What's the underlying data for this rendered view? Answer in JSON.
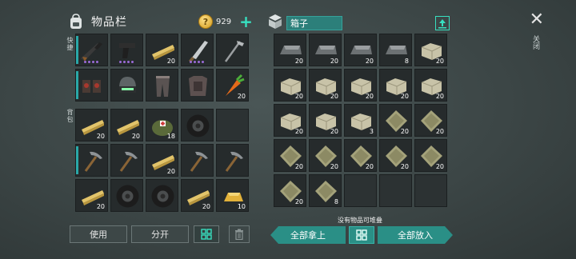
{
  "inventory": {
    "title": "物品栏",
    "coins": "929",
    "hotbar_label": "快捷",
    "backpack_label": "背包",
    "hotbar": [
      {
        "icon": "rifle-icon",
        "qty": "",
        "dots": 4
      },
      {
        "icon": "pistol-icon",
        "qty": "",
        "dots": 4
      },
      {
        "icon": "plank-icon",
        "qty": "20",
        "dots": 0
      },
      {
        "icon": "machete-icon",
        "qty": "",
        "dots": 4
      },
      {
        "icon": "hoe-icon",
        "qty": "",
        "dots": 0
      },
      {
        "icon": "boots-icon",
        "qty": "",
        "dots": 0
      },
      {
        "icon": "helmet-icon",
        "qty": "",
        "dots": 0
      },
      {
        "icon": "pants-icon",
        "qty": "",
        "dots": 0
      },
      {
        "icon": "chest-armor-icon",
        "qty": "",
        "dots": 0
      },
      {
        "icon": "carrot-icon",
        "qty": "20",
        "dots": 0
      }
    ],
    "backpack": [
      {
        "icon": "plank-icon",
        "qty": "20"
      },
      {
        "icon": "plank-icon",
        "qty": "20"
      },
      {
        "icon": "medkit-bag-icon",
        "qty": "18"
      },
      {
        "icon": "tire-icon",
        "qty": ""
      },
      {
        "icon": "",
        "qty": ""
      },
      {
        "icon": "pickaxe-icon",
        "qty": ""
      },
      {
        "icon": "pickaxe-icon",
        "qty": ""
      },
      {
        "icon": "plank-icon",
        "qty": "20"
      },
      {
        "icon": "pickaxe-icon",
        "qty": ""
      },
      {
        "icon": "pickaxe-icon",
        "qty": ""
      },
      {
        "icon": "plank-icon",
        "qty": "20"
      },
      {
        "icon": "tire-icon",
        "qty": ""
      },
      {
        "icon": "tire-icon",
        "qty": ""
      },
      {
        "icon": "plank-icon",
        "qty": "20"
      },
      {
        "icon": "gold-bar-icon",
        "qty": "10"
      }
    ],
    "use_label": "使用",
    "split_label": "分开"
  },
  "container": {
    "title": "箱子",
    "no_stack_text": "没有物品可堆叠",
    "take_all_label": "全部拿上",
    "put_all_label": "全部放入",
    "slots": [
      {
        "icon": "iron-ingot-icon",
        "qty": "20"
      },
      {
        "icon": "iron-ingot-icon",
        "qty": "20"
      },
      {
        "icon": "iron-ingot-icon",
        "qty": "20"
      },
      {
        "icon": "iron-ingot-icon",
        "qty": "8"
      },
      {
        "icon": "stone-block-icon",
        "qty": "20"
      },
      {
        "icon": "stone-block-icon",
        "qty": "20"
      },
      {
        "icon": "stone-block-icon",
        "qty": "20"
      },
      {
        "icon": "stone-block-icon",
        "qty": "20"
      },
      {
        "icon": "stone-block-icon",
        "qty": "20"
      },
      {
        "icon": "stone-block-icon",
        "qty": "20"
      },
      {
        "icon": "stone-block-icon",
        "qty": "20"
      },
      {
        "icon": "stone-block-icon",
        "qty": "20"
      },
      {
        "icon": "stone-block-icon",
        "qty": "3"
      },
      {
        "icon": "sack-icon",
        "qty": "20"
      },
      {
        "icon": "sack-icon",
        "qty": "20"
      },
      {
        "icon": "sack-icon",
        "qty": "20"
      },
      {
        "icon": "sack-icon",
        "qty": "20"
      },
      {
        "icon": "sack-icon",
        "qty": "20"
      },
      {
        "icon": "sack-icon",
        "qty": "20"
      },
      {
        "icon": "sack-icon",
        "qty": "20"
      },
      {
        "icon": "sack-icon",
        "qty": "20"
      },
      {
        "icon": "sack-icon",
        "qty": "8"
      },
      {
        "icon": "",
        "qty": ""
      },
      {
        "icon": "",
        "qty": ""
      },
      {
        "icon": "",
        "qty": ""
      }
    ]
  },
  "close_label": "关闭",
  "colors": {
    "accent": "#2aa8a8",
    "teal_button": "#2a8f86",
    "slot_bg": "#262b2c",
    "rarity_dot": "#9b6bd8"
  }
}
